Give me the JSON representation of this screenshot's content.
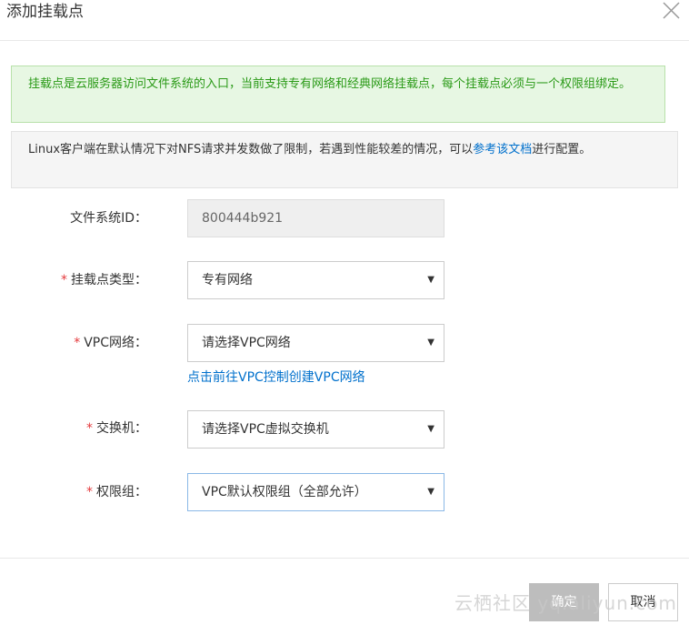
{
  "dialog": {
    "title": "添加挂载点",
    "close_icon": "close-icon"
  },
  "alerts": {
    "success_text": "挂载点是云服务器访问文件系统的入口，当前支持专有网络和经典网络挂载点，每个挂载点必须与一个权限组绑定。",
    "info_prefix": "Linux客户端在默认情况下对NFS请求并发数做了限制，若遇到性能较差的情况，可以",
    "info_link": "参考该文档",
    "info_suffix": "进行配置。"
  },
  "form": {
    "fs_id": {
      "label": "文件系统ID：",
      "value": "800444b921"
    },
    "mount_type": {
      "label": "挂载点类型：",
      "value": "专有网络"
    },
    "vpc": {
      "label": "VPC网络：",
      "value": "请选择VPC网络",
      "help_link": "点击前往VPC控制创建VPC网络"
    },
    "vswitch": {
      "label": "交换机：",
      "value": "请选择VPC虚拟交换机"
    },
    "permission_group": {
      "label": "权限组：",
      "value": "VPC默认权限组（全部允许）"
    },
    "required_mark": "*",
    "caret_icon": "caret-down-icon"
  },
  "footer": {
    "confirm_label": "确定",
    "cancel_label": "取消"
  },
  "watermark": "云栖社区 yq.aliyun.com",
  "colors": {
    "link": "#0070cc",
    "required": "#e4393c",
    "success_bg": "#e7f7e3",
    "success_text": "#2a9a17",
    "disabled_button": "#bdbdbd"
  }
}
